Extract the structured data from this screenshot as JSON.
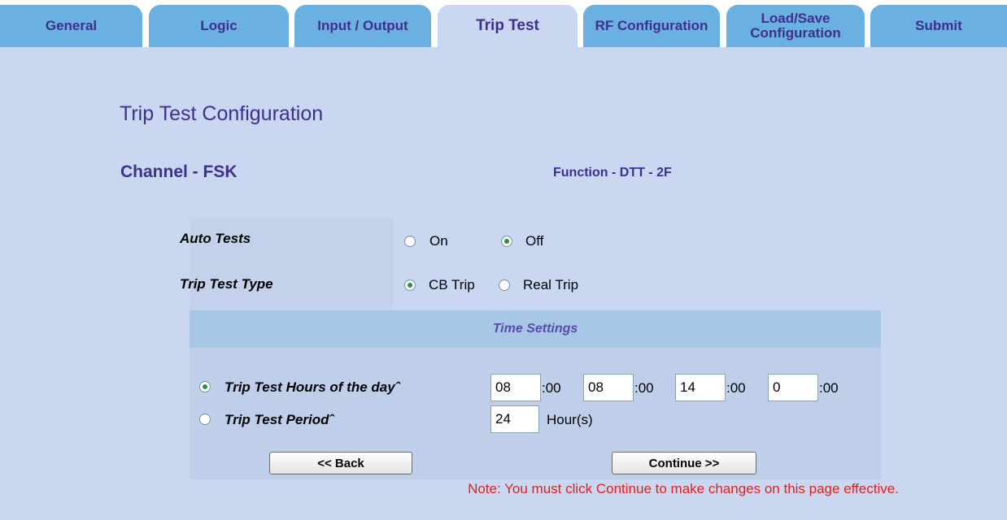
{
  "tabs": [
    {
      "label": "General",
      "active": false
    },
    {
      "label": "Logic",
      "active": false
    },
    {
      "label": "Input / Output",
      "active": false
    },
    {
      "label": "Trip Test",
      "active": true
    },
    {
      "label": "RF Configuration",
      "active": false
    },
    {
      "label": "Load/Save Configuration",
      "active": false
    },
    {
      "label": "Submit",
      "active": false
    }
  ],
  "page": {
    "title": "Trip Test Configuration",
    "channel": "Channel - FSK",
    "function": "Function - DTT - 2F"
  },
  "auto_tests": {
    "label": "Auto Tests",
    "options": [
      "On",
      "Off"
    ],
    "selected": "Off"
  },
  "trip_test_type": {
    "label": "Trip Test Type",
    "options": [
      "CB Trip",
      "Real Trip"
    ],
    "selected": "CB Trip"
  },
  "time_settings": {
    "header": "Time Settings",
    "hours_of_day": {
      "label": "Trip Test Hours of the dayˆ",
      "selected": true,
      "values": [
        "08",
        "08",
        "14",
        "0"
      ],
      "suffix": ":00"
    },
    "period": {
      "label": "Trip Test Periodˆ",
      "selected": false,
      "value": "24",
      "unit": "Hour(s)"
    }
  },
  "buttons": {
    "back": "<< Back",
    "continue": "Continue >>"
  },
  "note": "Note: You must click Continue to make changes on this page effective.",
  "colors": {
    "tab": "#6ab0e0",
    "panel": "#c9d8f0",
    "title_text": "#3f2f8f",
    "note_text": "#e02020",
    "section_header": "#a8c7e6"
  }
}
